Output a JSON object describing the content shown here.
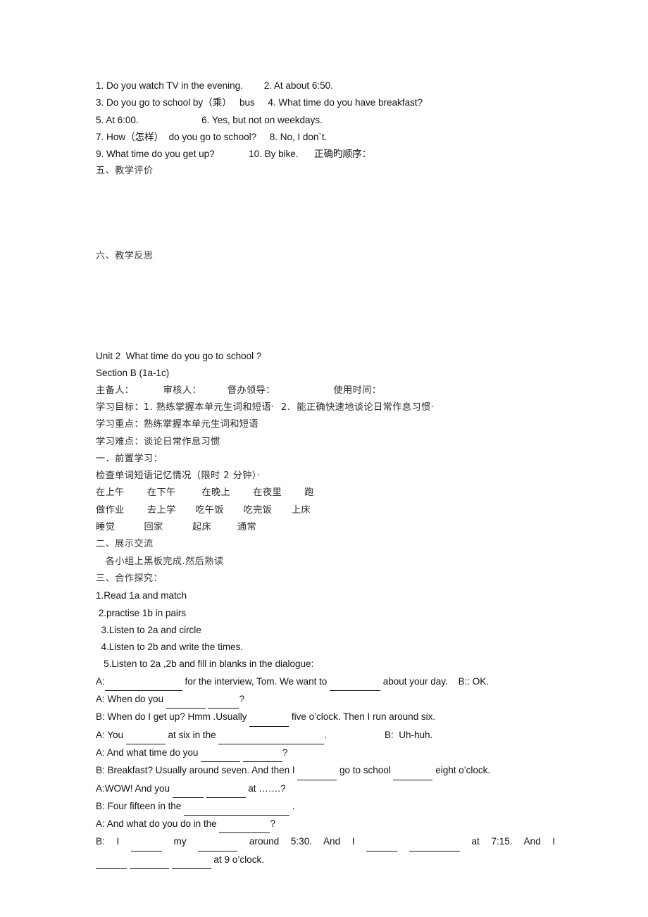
{
  "document": {
    "type": "lesson-plan-scan",
    "page_background": "#ffffff",
    "text_color": "#141414"
  },
  "matching_exercise": {
    "lines": [
      "1. Do you watch TV in the evening.        2. At about 6:50.",
      "3. Do you go to school by（乘）   bus     4. What time do you have breakfast?",
      "5. At 6:00.                        6. Yes, but not on weekdays.",
      "7. How（怎样）  do you go to school?     8. No, I don`t.",
      "9. What time do you get up?             10. By bike.      正确旳顺序："
    ]
  },
  "sections": {
    "evaluation": "五、教学评价",
    "reflection": "六、教学反思"
  },
  "unit": {
    "title": "Unit 2  What time do you go to school ?",
    "section": "Section B (1a-1c)",
    "meta_row": "主备人：         审核人：        督办领导：                  使用时间：",
    "objectives": "学习目标：1. 熟练掌握本单元生词和短语·  2.  能正确快速地谈论日常作息习惯·",
    "key_points": "学习重点：熟练掌握本单元生词和短语",
    "difficulties": "学习难点：谈论日常作息习惯"
  },
  "pre_study": {
    "heading": "一．前置学习：",
    "instruction": "检查单词短语记忆情况（限时 2 分钟）·",
    "vocab_rows": [
      "在上午       在下午        在晚上       在夜里       跑",
      "做作业       去上学      吃午饭      吃完饭      上床",
      "睡觉         回家         起床        通常"
    ]
  },
  "display_exchange": {
    "heading": "二、展示交流",
    "body": "   各小组上黑板完成.然后熟读"
  },
  "cooperative_inquiry": {
    "heading": "三、合作探究：",
    "activities": [
      "1.Read 1a and match",
      " 2.practise 1b in pairs",
      "  3.Listen to 2a and circle",
      "  4.Listen to 2b and write the times.",
      "   5.Listen to 2a ,2b and fill in blanks in the dialogue:"
    ]
  },
  "dialogue": {
    "lines": [
      {
        "parts": [
          {
            "t": "A:",
            "type": "text"
          },
          {
            "t": "",
            "type": "blank",
            "size": "b-l"
          },
          {
            "t": " for the interview, Tom. We want to ",
            "type": "text"
          },
          {
            "t": "",
            "type": "blank",
            "size": "b-m"
          },
          {
            "t": " about your day.    B:: OK.",
            "type": "text"
          }
        ]
      },
      {
        "parts": [
          {
            "t": "A: When do you ",
            "type": "text"
          },
          {
            "t": "",
            "type": "blank",
            "size": "b-s"
          },
          {
            "t": " ",
            "type": "text"
          },
          {
            "t": "",
            "type": "blank",
            "size": "b-xs"
          },
          {
            "t": "?",
            "type": "text"
          }
        ]
      },
      {
        "parts": [
          {
            "t": "B: When do I get up? Hmm .Usually ",
            "type": "text"
          },
          {
            "t": "",
            "type": "blank",
            "size": "b-s"
          },
          {
            "t": " five o’clock. Then I run around six.",
            "type": "text"
          }
        ]
      },
      {
        "parts": [
          {
            "t": "A: You ",
            "type": "text"
          },
          {
            "t": "",
            "type": "blank",
            "size": "b-s"
          },
          {
            "t": " at six in the ",
            "type": "text"
          },
          {
            "t": "",
            "type": "blank",
            "size": "b-xl"
          },
          {
            "t": ".                      B:  Uh-huh.",
            "type": "text"
          }
        ]
      },
      {
        "parts": [
          {
            "t": "A: And what time do you ",
            "type": "text"
          },
          {
            "t": "",
            "type": "blank",
            "size": "b-s"
          },
          {
            "t": " ",
            "type": "text"
          },
          {
            "t": "",
            "type": "blank",
            "size": "b-s"
          },
          {
            "t": "?",
            "type": "text"
          }
        ]
      },
      {
        "parts": [
          {
            "t": "B: Breakfast? Usually around seven. And then I ",
            "type": "text"
          },
          {
            "t": "",
            "type": "blank",
            "size": "b-s"
          },
          {
            "t": " go to school ",
            "type": "text"
          },
          {
            "t": "",
            "type": "blank",
            "size": "b-s"
          },
          {
            "t": " eight o’clock.",
            "type": "text"
          }
        ]
      },
      {
        "parts": [
          {
            "t": "A:WOW! And you ",
            "type": "text"
          },
          {
            "t": "",
            "type": "blank",
            "size": "b-xs"
          },
          {
            "t": " ",
            "type": "text"
          },
          {
            "t": "",
            "type": "blank",
            "size": "b-s"
          },
          {
            "t": " at …….?",
            "type": "text"
          }
        ]
      },
      {
        "parts": [
          {
            "t": "B: Four fifteen in the ",
            "type": "text"
          },
          {
            "t": "",
            "type": "blank",
            "size": "b-xl"
          },
          {
            "t": " .",
            "type": "text"
          }
        ]
      },
      {
        "parts": [
          {
            "t": "A: And what do you do in the ",
            "type": "text"
          },
          {
            "t": "",
            "type": "blank",
            "size": "b-m"
          },
          {
            "t": "?",
            "type": "text"
          }
        ]
      }
    ],
    "justified_line": {
      "tokens": [
        "B:",
        "I",
        "BLANK:b-xs",
        "my",
        "BLANK:b-s",
        "around",
        "5:30.",
        "And",
        "I",
        "BLANK:b-xs",
        "BLANK:b-m",
        "at",
        "7:15.",
        "And",
        "I"
      ]
    },
    "final_line": {
      "parts": [
        {
          "t": "",
          "type": "blank",
          "size": "b-xs"
        },
        {
          "t": " ",
          "type": "text"
        },
        {
          "t": "",
          "type": "blank",
          "size": "b-s"
        },
        {
          "t": " ",
          "type": "text"
        },
        {
          "t": "",
          "type": "blank",
          "size": "b-s"
        },
        {
          "t": " at 9 o’clock.",
          "type": "text"
        }
      ]
    }
  }
}
